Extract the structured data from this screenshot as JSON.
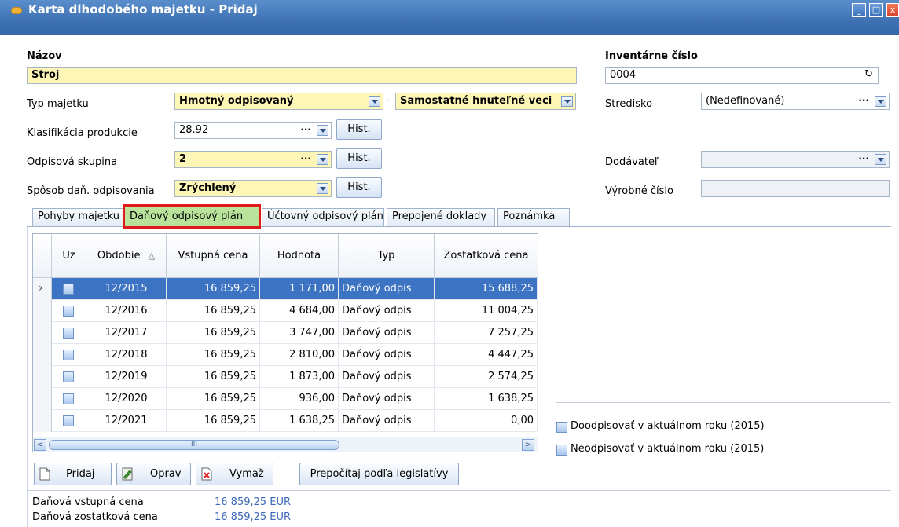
{
  "window": {
    "title": "Karta dlhodobého majetku - Pridaj"
  },
  "form": {
    "nazov_label": "Názov",
    "nazov_value": "Stroj",
    "inv_label": "Inventárne číslo",
    "inv_value": "0004",
    "typ_label": "Typ majetku",
    "typ_value": "Hmotný odpisovaný",
    "typ_dash": "-",
    "typ2_value": "Samostatné hnuteľné veci",
    "stredisko_label": "Stredisko",
    "stredisko_value": "(Nedefinované)",
    "klas_label": "Klasifikácia produkcie",
    "klas_value": "28.92",
    "odp_label": "Odpisová skupina",
    "odp_value": "2",
    "dodavatel_label": "Dodávateľ",
    "dodavatel_value": "",
    "sposob_label": "Spôsob daň. odpisovania",
    "sposob_value": "Zrýchlený",
    "vyrobne_label": "Výrobné číslo",
    "vyrobne_value": "",
    "hist_label": "Hist.",
    "dots": "···"
  },
  "tabs": [
    {
      "label": "Pohyby majetku"
    },
    {
      "label": "Daňový odpisový plán"
    },
    {
      "label": "Účtovný odpisový plán"
    },
    {
      "label": "Prepojené doklady"
    },
    {
      "label": "Poznámka"
    }
  ],
  "grid": {
    "columns": [
      "Uz",
      "Obdobie",
      "Vstupná cena",
      "Hodnota",
      "Typ",
      "Zostatková cena"
    ],
    "sort_glyph": "△",
    "rows": [
      {
        "obdobie": "12/2015",
        "vstupna": "16 859,25",
        "hodnota": "1 171,00",
        "typ": "Daňový odpis",
        "zostatkova": "15 688,25",
        "selected": true
      },
      {
        "obdobie": "12/2016",
        "vstupna": "16 859,25",
        "hodnota": "4 684,00",
        "typ": "Daňový odpis",
        "zostatkova": "11 004,25",
        "selected": false
      },
      {
        "obdobie": "12/2017",
        "vstupna": "16 859,25",
        "hodnota": "3 747,00",
        "typ": "Daňový odpis",
        "zostatkova": "7 257,25",
        "selected": false
      },
      {
        "obdobie": "12/2018",
        "vstupna": "16 859,25",
        "hodnota": "2 810,00",
        "typ": "Daňový odpis",
        "zostatkova": "4 447,25",
        "selected": false
      },
      {
        "obdobie": "12/2019",
        "vstupna": "16 859,25",
        "hodnota": "1 873,00",
        "typ": "Daňový odpis",
        "zostatkova": "2 574,25",
        "selected": false
      },
      {
        "obdobie": "12/2020",
        "vstupna": "16 859,25",
        "hodnota": "936,00",
        "typ": "Daňový odpis",
        "zostatkova": "1 638,25",
        "selected": false
      },
      {
        "obdobie": "12/2021",
        "vstupna": "16 859,25",
        "hodnota": "1 638,25",
        "typ": "Daňový odpis",
        "zostatkova": "0,00",
        "selected": false
      }
    ],
    "row_indicator": "›",
    "scroll_thumb_grip": "III"
  },
  "side": {
    "doodpisovat": "Doodpisovať v aktuálnom roku (2015)",
    "neodpisovat": "Neodpisovať v aktuálnom roku (2015)"
  },
  "actions": {
    "pridaj": "Pridaj",
    "oprav": "Oprav",
    "vymaz": "Vymaž",
    "prepocitaj": "Prepočítaj podľa legislatívy"
  },
  "summary": {
    "vstupna_label": "Daňová vstupná cena",
    "vstupna_value": "16 859,25 EUR",
    "zostatkova_label": "Daňová zostatková cena",
    "zostatkova_value": "16 859,25 EUR"
  },
  "colors": {
    "title_bar": "#3f72b4",
    "required_field": "#fdf6b7",
    "selected_row": "#3d73c3",
    "active_tab": "#b9e39a",
    "highlight_border": "#e01a1a",
    "value_text": "#3b68b8"
  }
}
